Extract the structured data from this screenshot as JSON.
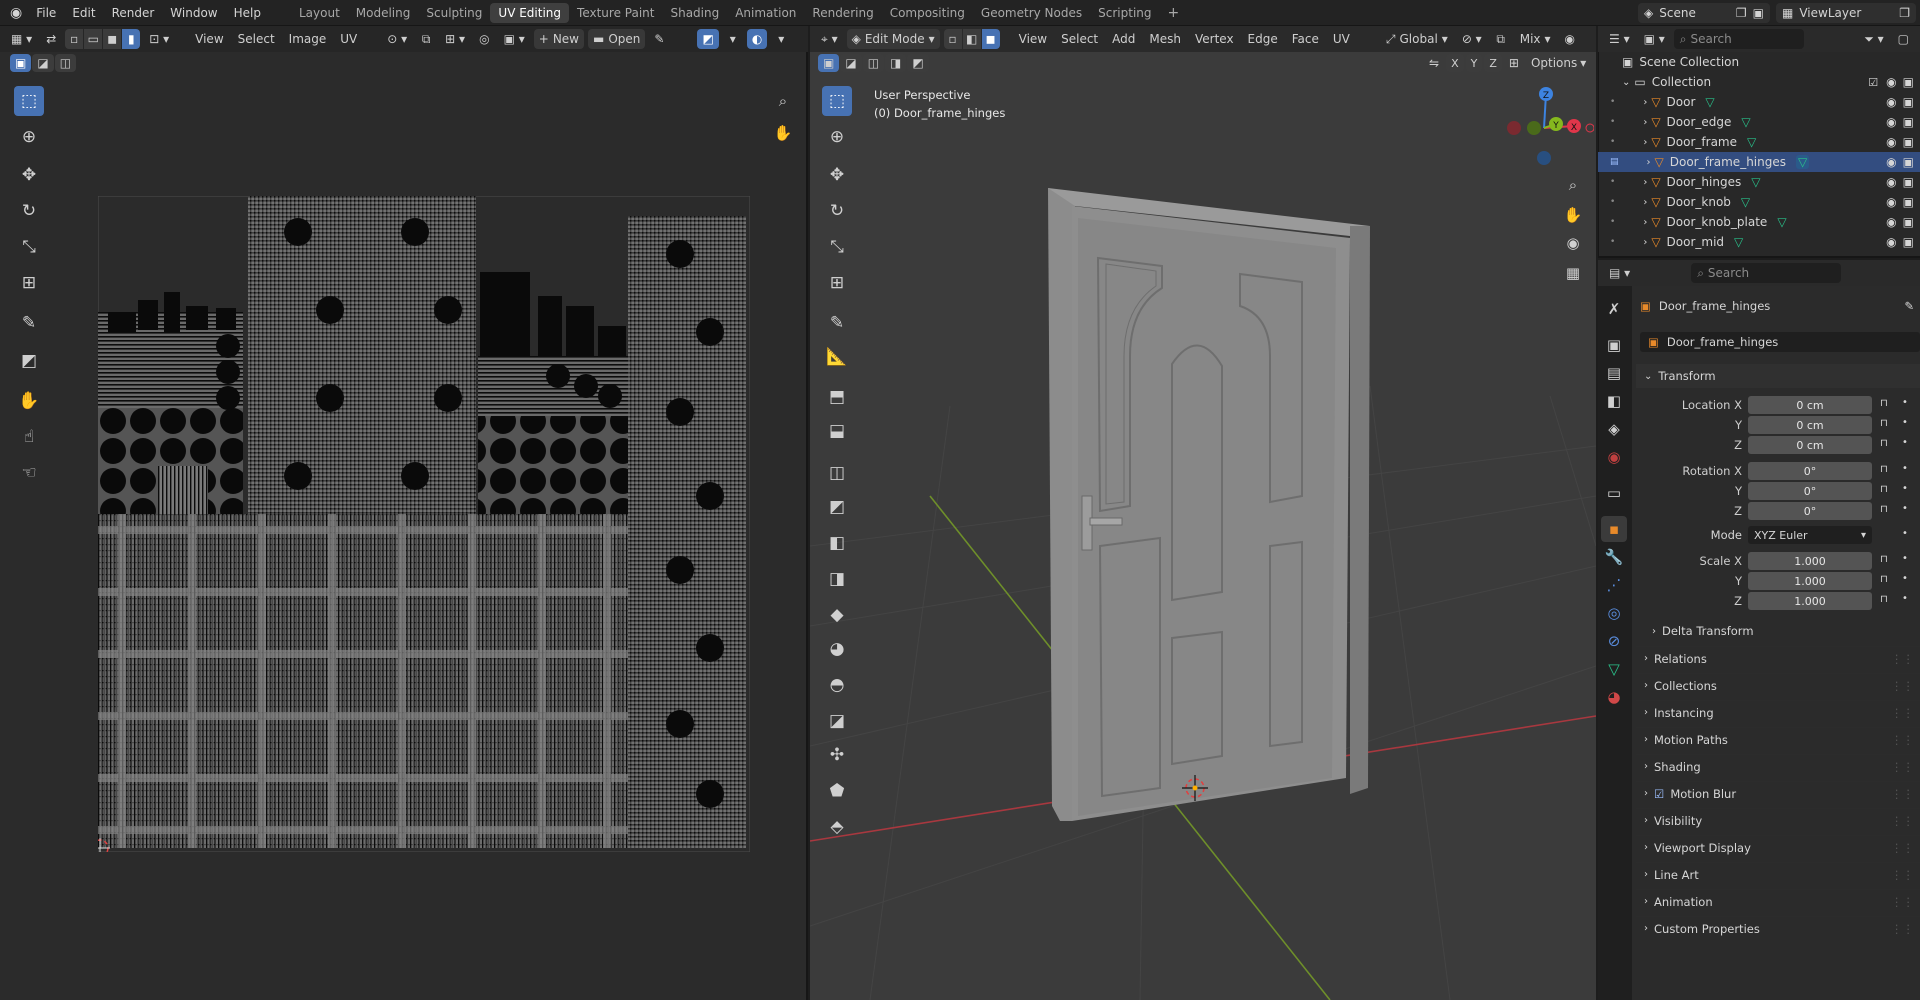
{
  "topbar": {
    "menus": [
      "File",
      "Edit",
      "Render",
      "Window",
      "Help"
    ],
    "workspaces": [
      "Layout",
      "Modeling",
      "Sculpting",
      "UV Editing",
      "Texture Paint",
      "Shading",
      "Animation",
      "Rendering",
      "Compositing",
      "Geometry Nodes",
      "Scripting"
    ],
    "active_workspace": "UV Editing",
    "add_workspace": "+",
    "scene_label": "Scene",
    "viewlayer_label": "ViewLayer"
  },
  "uv_editor": {
    "menus": [
      "View",
      "Select",
      "Image",
      "UV"
    ],
    "new_label": "New",
    "open_label": "Open"
  },
  "viewport": {
    "mode_label": "Edit Mode",
    "menus": [
      "View",
      "Select",
      "Add",
      "Mesh",
      "Vertex",
      "Edge",
      "Face",
      "UV"
    ],
    "transform_orientation": "Global",
    "shading_mix": "Mix",
    "axis_buttons": [
      "X",
      "Y",
      "Z"
    ],
    "options_label": "Options",
    "overlay_line1": "User Perspective",
    "overlay_line2": "(0) Door_frame_hinges",
    "gizmo": {
      "x": "X",
      "y": "Y",
      "z": "Z"
    }
  },
  "outliner": {
    "search_placeholder": "Search",
    "scene_collection": "Scene Collection",
    "collection": "Collection",
    "items": [
      {
        "name": "Door",
        "selected": false
      },
      {
        "name": "Door_edge",
        "selected": false
      },
      {
        "name": "Door_frame",
        "selected": false
      },
      {
        "name": "Door_frame_hinges",
        "selected": true
      },
      {
        "name": "Door_hinges",
        "selected": false
      },
      {
        "name": "Door_knob",
        "selected": false
      },
      {
        "name": "Door_knob_plate",
        "selected": false
      },
      {
        "name": "Door_mid",
        "selected": false
      }
    ]
  },
  "properties": {
    "search_placeholder": "Search",
    "object_name": "Door_frame_hinges",
    "object_field": "Door_frame_hinges",
    "transform_title": "Transform",
    "location_label": "Location X",
    "rotation_label": "Rotation X",
    "scale_label": "Scale X",
    "y_label": "Y",
    "z_label": "Z",
    "mode_label": "Mode",
    "location": [
      "0 cm",
      "0 cm",
      "0 cm"
    ],
    "rotation": [
      "0°",
      "0°",
      "0°"
    ],
    "rotation_mode": "XYZ Euler",
    "scale": [
      "1.000",
      "1.000",
      "1.000"
    ],
    "delta_transform": "Delta Transform",
    "panels": [
      "Relations",
      "Collections",
      "Instancing",
      "Motion Paths",
      "Shading",
      "Motion Blur",
      "Visibility",
      "Viewport Display",
      "Line Art",
      "Animation",
      "Custom Properties"
    ]
  },
  "colors": {
    "accent": "#4772b3",
    "selected_row": "#334d80",
    "x_axis": "#e0364a",
    "y_axis": "#85b81e",
    "z_axis": "#3d83e0"
  }
}
